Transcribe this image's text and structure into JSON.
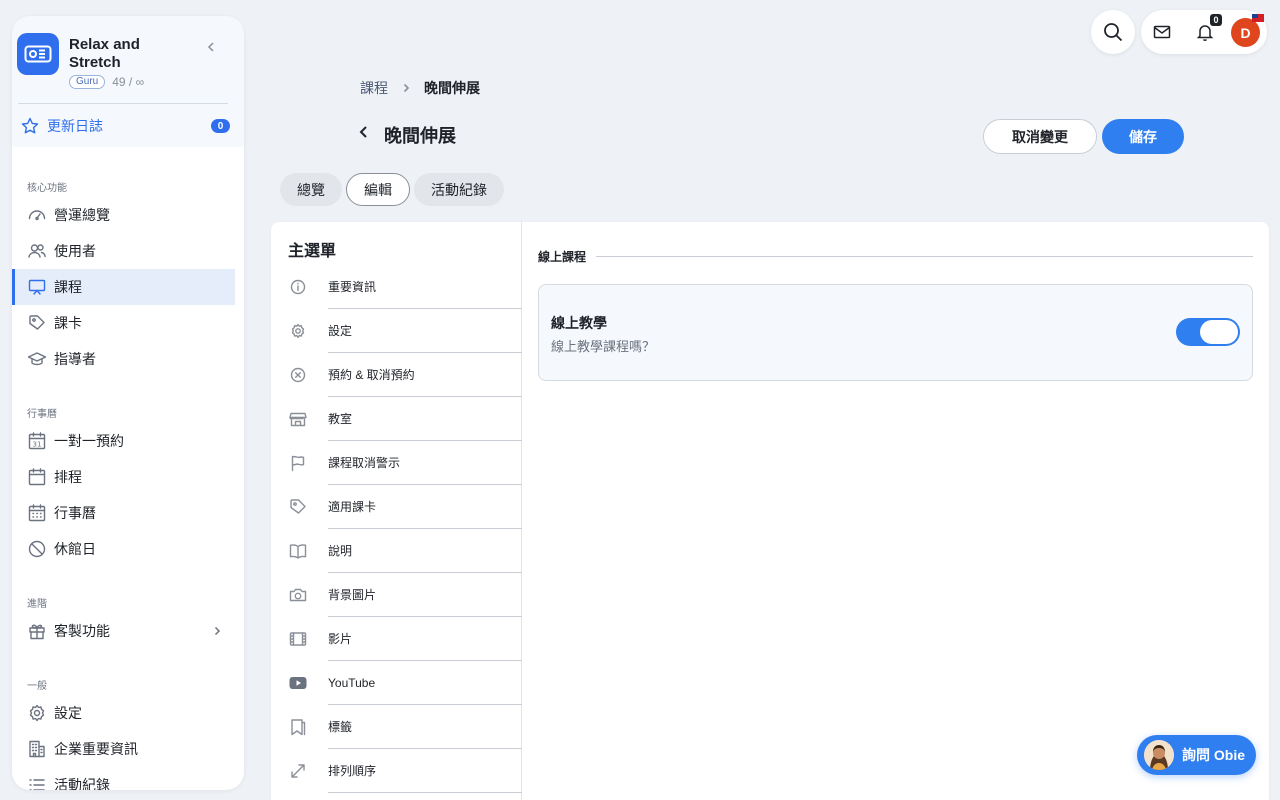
{
  "org": {
    "name": "Relax and Stretch",
    "plan": "Guru",
    "usage": "49 / ∞"
  },
  "changelog": {
    "label": "更新日誌",
    "count": "0"
  },
  "sidebar": {
    "sections": [
      {
        "title": "核心功能",
        "items": [
          {
            "label": "營運總覽",
            "icon": "dashboard-icon"
          },
          {
            "label": "使用者",
            "icon": "users-icon"
          },
          {
            "label": "課程",
            "icon": "presentation-icon",
            "active": true
          },
          {
            "label": "課卡",
            "icon": "tag-icon"
          },
          {
            "label": "指導者",
            "icon": "graduation-cap-icon"
          }
        ]
      },
      {
        "title": "行事曆",
        "items": [
          {
            "label": "一對一預約",
            "icon": "calendar-31-icon"
          },
          {
            "label": "排程",
            "icon": "calendar-icon"
          },
          {
            "label": "行事曆",
            "icon": "calendar-grid-icon"
          },
          {
            "label": "休館日",
            "icon": "forbidden-icon"
          }
        ]
      },
      {
        "title": "進階",
        "items": [
          {
            "label": "客製功能",
            "icon": "gift-icon"
          }
        ]
      },
      {
        "title": "一般",
        "items": [
          {
            "label": "設定",
            "icon": "gear-icon"
          },
          {
            "label": "企業重要資訊",
            "icon": "building-icon"
          },
          {
            "label": "活動紀錄",
            "icon": "list-icon"
          }
        ]
      }
    ]
  },
  "topbar": {
    "notification_count": "0",
    "avatar_initial": "D"
  },
  "breadcrumb": {
    "parent": "課程",
    "current": "晚間伸展"
  },
  "page": {
    "title": "晚間伸展",
    "cancel_label": "取消變更",
    "save_label": "儲存"
  },
  "tabs": [
    {
      "label": "總覽"
    },
    {
      "label": "編輯",
      "active": true
    },
    {
      "label": "活動紀錄"
    }
  ],
  "menu": {
    "title": "主選單",
    "items": [
      {
        "label": "重要資訊",
        "icon": "info-icon"
      },
      {
        "label": "設定",
        "icon": "gear-icon"
      },
      {
        "label": "預約 & 取消預約",
        "icon": "cancel-circle-icon"
      },
      {
        "label": "教室",
        "icon": "store-icon"
      },
      {
        "label": "課程取消警示",
        "icon": "flag-icon"
      },
      {
        "label": "適用課卡",
        "icon": "tag-icon"
      },
      {
        "label": "說明",
        "icon": "book-icon"
      },
      {
        "label": "背景圖片",
        "icon": "camera-icon"
      },
      {
        "label": "影片",
        "icon": "film-icon"
      },
      {
        "label": "YouTube",
        "icon": "youtube-icon"
      },
      {
        "label": "標籤",
        "icon": "bookmark-icon"
      },
      {
        "label": "排列順序",
        "icon": "resize-icon"
      }
    ]
  },
  "section": {
    "title": "線上課程",
    "setting": {
      "name": "線上教學",
      "description": "線上教學課程嗎？",
      "enabled": true
    }
  },
  "chat": {
    "label": "詢問 Obie"
  },
  "colors": {
    "accent": "#2f7ff0",
    "avatar": "#e0461d"
  }
}
